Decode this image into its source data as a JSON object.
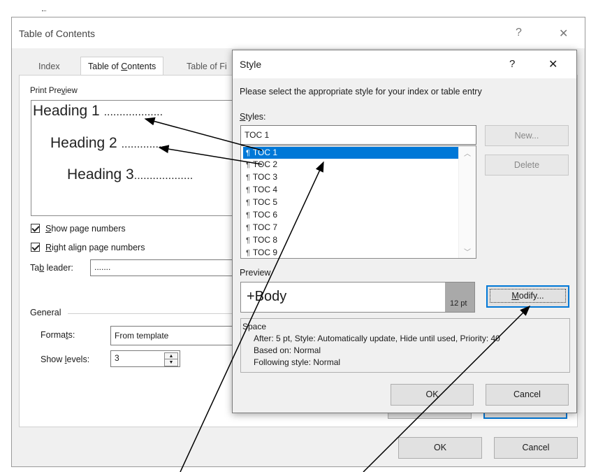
{
  "toc_dialog": {
    "title": "Table of Contents",
    "help": "?",
    "close": "✕",
    "tabs": [
      "Index",
      "Table of Contents",
      "Table of Fi"
    ],
    "print_preview_label": "Print Preview",
    "preview_headings": [
      {
        "text": "Heading 1",
        "leader": "..................."
      },
      {
        "text": "Heading 2",
        "leader": "..............."
      },
      {
        "text": "Heading 3",
        "leader": "..................."
      }
    ],
    "show_page_numbers": "Show page numbers",
    "right_align": "Right align page numbers",
    "tab_leader_label": "Tab leader:",
    "tab_leader_value": ".......",
    "general_label": "General",
    "formats_label": "Formats:",
    "formats_value": "From template",
    "show_levels_label": "Show levels:",
    "show_levels_value": "3",
    "ok": "OK",
    "cancel": "Cancel"
  },
  "style_dialog": {
    "title": "Style",
    "help": "?",
    "close": "✕",
    "instruction": "Please select the appropriate style for your index or table entry",
    "styles_label": "Styles:",
    "styles_value": "TOC 1",
    "styles": [
      "TOC 1",
      "TOC 2",
      "TOC 3",
      "TOC 4",
      "TOC 5",
      "TOC 6",
      "TOC 7",
      "TOC 8",
      "TOC 9"
    ],
    "selected_style": "TOC 1",
    "new_button": "New...",
    "delete_button": "Delete",
    "preview_label": "Preview",
    "preview_font": "+Body",
    "preview_size": "12 pt",
    "modify_button": "Modify...",
    "description": [
      "Space",
      "After:  5 pt, Style: Automatically update, Hide until used, Priority: 40",
      "Based on: Normal",
      "Following style: Normal"
    ],
    "ok": "OK",
    "cancel": "Cancel"
  },
  "colors": {
    "selection": "#0078d7",
    "dialog_bg": "#f0f0f0"
  }
}
